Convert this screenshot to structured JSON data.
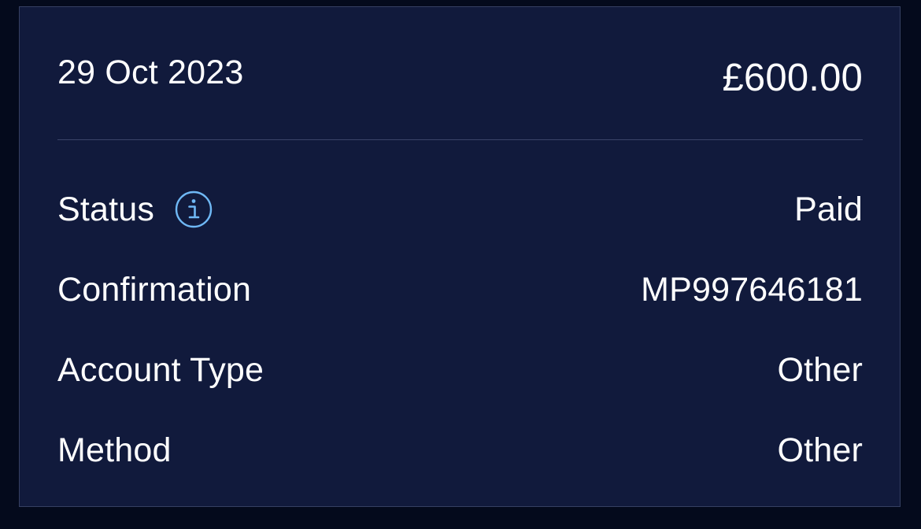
{
  "transaction": {
    "date": "29 Oct 2023",
    "amount": "£600.00"
  },
  "details": [
    {
      "label": "Status",
      "value": "Paid",
      "has_info_icon": true
    },
    {
      "label": "Confirmation",
      "value": "MP997646181"
    },
    {
      "label": "Account Type",
      "value": "Other"
    },
    {
      "label": "Method",
      "value": "Other"
    }
  ],
  "icons": {
    "status_info": "info-circle-icon"
  },
  "colors": {
    "background": "#040a1c",
    "card": "#111a3c",
    "text": "#ffffff",
    "info_accent": "#6fb8f5",
    "divider": "#3a4468"
  }
}
